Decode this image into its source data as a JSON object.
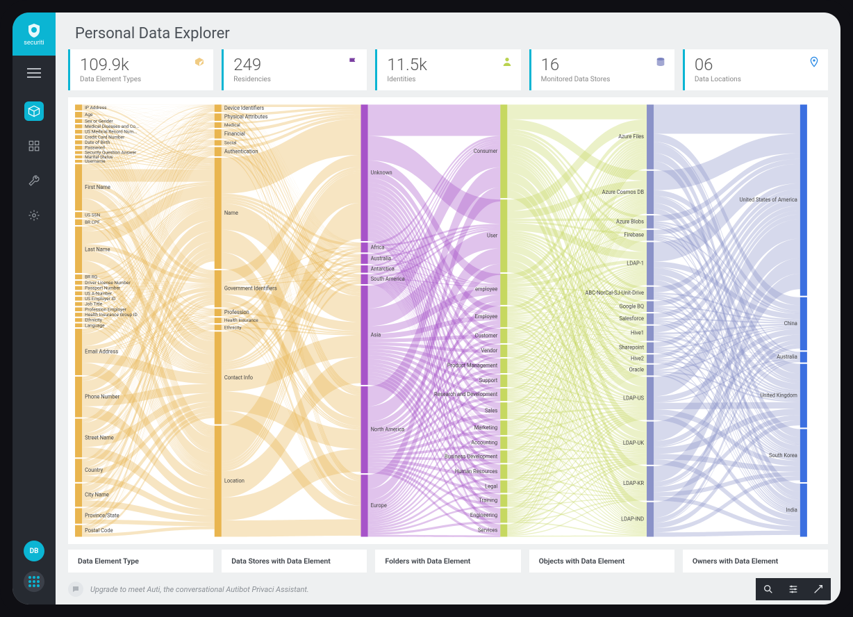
{
  "brand": "securiti",
  "page_title": "Personal Data Explorer",
  "avatar_initials": "DB",
  "stats": [
    {
      "value": "109.9k",
      "label": "Data Element Types",
      "icon": "cube",
      "color": "#e9b54f"
    },
    {
      "value": "249",
      "label": "Residencies",
      "icon": "flag",
      "color": "#7a3fa1"
    },
    {
      "value": "11.5k",
      "label": "Identities",
      "icon": "person",
      "color": "#b9d24f"
    },
    {
      "value": "16",
      "label": "Monitored Data Stores",
      "icon": "database",
      "color": "#7a82bf"
    },
    {
      "value": "06",
      "label": "Data Locations",
      "icon": "pin",
      "color": "#2e8de6"
    }
  ],
  "column_footers": [
    "Data Element Type",
    "Data Stores with Data Element",
    "Folders with Data Element",
    "Objects with Data Element",
    "Owners with Data Element"
  ],
  "chat_hint": "Upgrade to meet Auti, the conversational Autibot Privaci Assistant.",
  "chart_data": {
    "type": "sankey",
    "columns": [
      {
        "name": "Data Element Type",
        "color": "#e9b54f",
        "nodes": [
          {
            "label": "IP Address",
            "weight": 6
          },
          {
            "label": "Age",
            "weight": 6
          },
          {
            "label": "Sex or Gender",
            "weight": 4
          },
          {
            "label": "Medical Diseases and Co...",
            "weight": 4
          },
          {
            "label": "US Medical Record Num...",
            "weight": 4
          },
          {
            "label": "Credit Card Number",
            "weight": 4
          },
          {
            "label": "Date of Birth",
            "weight": 4
          },
          {
            "label": "Password",
            "weight": 4
          },
          {
            "label": "Security Question Answer",
            "weight": 3
          },
          {
            "label": "Marital Status",
            "weight": 3
          },
          {
            "label": "Username",
            "weight": 3
          },
          {
            "label": "First Name",
            "weight": 48
          },
          {
            "label": "US SSN",
            "weight": 6
          },
          {
            "label": "BR CPF",
            "weight": 6
          },
          {
            "label": "Last Name",
            "weight": 48
          },
          {
            "label": "BR RG",
            "weight": 5
          },
          {
            "label": "Driver License Number",
            "weight": 4
          },
          {
            "label": "Passport Number",
            "weight": 4
          },
          {
            "label": "US A-Number",
            "weight": 4
          },
          {
            "label": "US Employer ID",
            "weight": 4
          },
          {
            "label": "Job Title",
            "weight": 4
          },
          {
            "label": "Profession Employer",
            "weight": 4
          },
          {
            "label": "Health Insurance Group ID",
            "weight": 4
          },
          {
            "label": "Ethnicity",
            "weight": 4
          },
          {
            "label": "Language",
            "weight": 4
          },
          {
            "label": "Email Address",
            "weight": 48
          },
          {
            "label": "Phone Number",
            "weight": 42
          },
          {
            "label": "Street Name",
            "weight": 40
          },
          {
            "label": "Country",
            "weight": 24
          },
          {
            "label": "City Name",
            "weight": 24
          },
          {
            "label": "Province/State",
            "weight": 16
          },
          {
            "label": "Postal Code",
            "weight": 12
          }
        ]
      },
      {
        "name": "Data Stores with Data Element",
        "color": "#e9b54f",
        "nodes": [
          {
            "label": "Device Identifiers",
            "weight": 8
          },
          {
            "label": "Physical Attributes",
            "weight": 8
          },
          {
            "label": "Medical",
            "weight": 6
          },
          {
            "label": "Financial",
            "weight": 10
          },
          {
            "label": "Social",
            "weight": 6
          },
          {
            "label": "Authentication",
            "weight": 10
          },
          {
            "label": "Name",
            "weight": 120
          },
          {
            "label": "Government Identifiers",
            "weight": 40
          },
          {
            "label": "Profession",
            "weight": 8
          },
          {
            "label": "Health Insurance",
            "weight": 6
          },
          {
            "label": "Ethnicity",
            "weight": 6
          },
          {
            "label": "Contact Info",
            "weight": 100
          },
          {
            "label": "Location",
            "weight": 120
          }
        ]
      },
      {
        "name": "Folders with Data Element",
        "color": "#a753c9",
        "nodes": [
          {
            "label": "Unknown",
            "weight": 110
          },
          {
            "label": "Africa",
            "weight": 8
          },
          {
            "label": "Australia",
            "weight": 8
          },
          {
            "label": "Antarctica",
            "weight": 6
          },
          {
            "label": "South America",
            "weight": 8
          },
          {
            "label": "Asia",
            "weight": 80
          },
          {
            "label": "North America",
            "weight": 70
          },
          {
            "label": "Europe",
            "weight": 50
          }
        ]
      },
      {
        "name": "Objects with Data Element",
        "color": "#c6d860",
        "nodes": [
          {
            "label": "Consumer",
            "weight": 90
          },
          {
            "label": "User",
            "weight": 70
          },
          {
            "label": "employee",
            "weight": 30
          },
          {
            "label": "Employee",
            "weight": 20
          },
          {
            "label": "Customer",
            "weight": 14
          },
          {
            "label": "Vendor",
            "weight": 12
          },
          {
            "label": "Product Management",
            "weight": 14
          },
          {
            "label": "Support",
            "weight": 12
          },
          {
            "label": "Research and Development",
            "weight": 12
          },
          {
            "label": "Sales",
            "weight": 16
          },
          {
            "label": "Marketing",
            "weight": 14
          },
          {
            "label": "Accounting",
            "weight": 12
          },
          {
            "label": "Business Development",
            "weight": 12
          },
          {
            "label": "Human Resources",
            "weight": 14
          },
          {
            "label": "Legal",
            "weight": 12
          },
          {
            "label": "Training",
            "weight": 12
          },
          {
            "label": "Engineering",
            "weight": 14
          },
          {
            "label": "Services",
            "weight": 12
          }
        ]
      },
      {
        "name": "Owners with Data Element",
        "color": "#8a92c8",
        "nodes": [
          {
            "label": "Azure Files",
            "weight": 60
          },
          {
            "label": "Azure Cosmos DB",
            "weight": 40
          },
          {
            "label": "Azure Blobs",
            "weight": 12
          },
          {
            "label": "Firebase",
            "weight": 10
          },
          {
            "label": "LDAP-1",
            "weight": 40
          },
          {
            "label": "ABC-NorCal-SJ-Unit-Drive",
            "weight": 12
          },
          {
            "label": "Google BQ",
            "weight": 10
          },
          {
            "label": "Salesforce",
            "weight": 10
          },
          {
            "label": "Hive1",
            "weight": 14
          },
          {
            "label": "Sharepoint",
            "weight": 10
          },
          {
            "label": "Hive2",
            "weight": 8
          },
          {
            "label": "Oracle",
            "weight": 10
          },
          {
            "label": "LDAP-US",
            "weight": 40
          },
          {
            "label": "LDAP-UK",
            "weight": 40
          },
          {
            "label": "LDAP-KR",
            "weight": 32
          },
          {
            "label": "LDAP-IND",
            "weight": 32
          }
        ]
      },
      {
        "name": "Data Locations",
        "color": "#3b6fe0",
        "nodes": [
          {
            "label": "United States of America",
            "weight": 180
          },
          {
            "label": "China",
            "weight": 50
          },
          {
            "label": "Australia",
            "weight": 10
          },
          {
            "label": "United Kingdom",
            "weight": 60
          },
          {
            "label": "South Korea",
            "weight": 50
          },
          {
            "label": "India",
            "weight": 50
          }
        ]
      }
    ]
  }
}
